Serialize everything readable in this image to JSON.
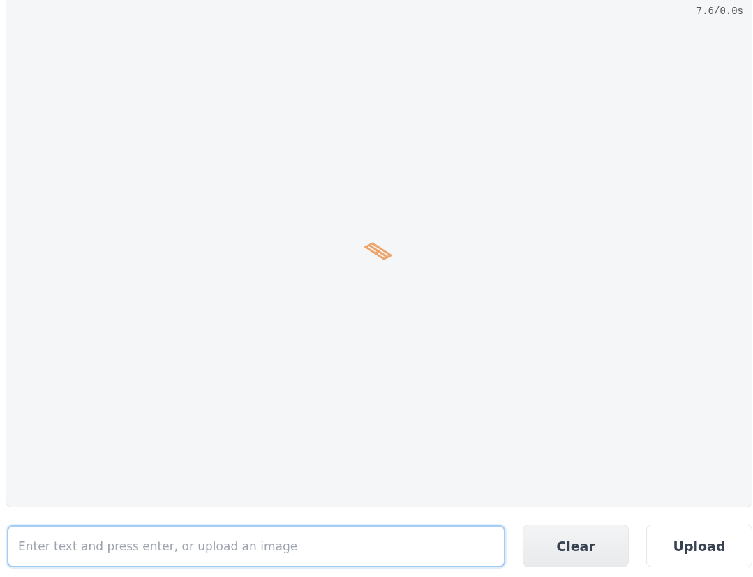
{
  "chatbot": {
    "timer": "7.6/0.0s",
    "loading": true
  },
  "input": {
    "placeholder": "Enter text and press enter, or upload an image",
    "focused": true
  },
  "buttons": [
    {
      "label": "Clear",
      "kind": "secondary"
    },
    {
      "label": "Upload",
      "kind": "plain"
    }
  ]
}
